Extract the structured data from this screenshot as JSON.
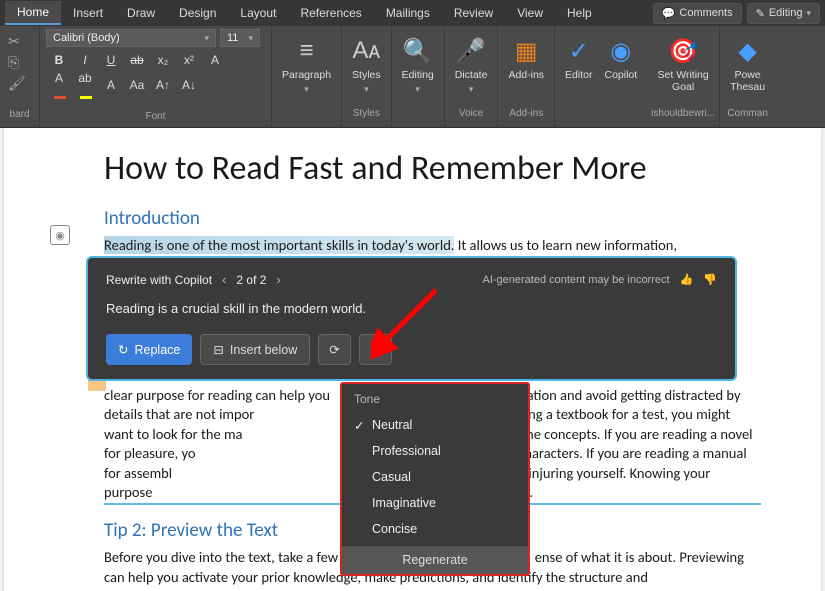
{
  "tabs": [
    "Home",
    "Insert",
    "Draw",
    "Design",
    "Layout",
    "References",
    "Mailings",
    "Review",
    "View",
    "Help"
  ],
  "active_tab": "Home",
  "top_right": {
    "comments": "Comments",
    "editing": "Editing"
  },
  "font": {
    "name": "Calibri (Body)",
    "size": "11"
  },
  "ribbon": {
    "clipboard_label": "bard",
    "font_label": "Font",
    "paragraph": "Paragraph",
    "styles": "Styles",
    "styles_label": "Styles",
    "editing": "Editing",
    "dictate": "Dictate",
    "voice_label": "Voice",
    "addins": "Add-ins",
    "addins_label": "Add-ins",
    "editor": "Editor",
    "copilot": "Copilot",
    "set_writing_goal": "Set Writing\nGoal",
    "ishould_label": "ishouldbewri...",
    "power_thesaurus": "Powe\nThesau",
    "commands_label": "Comman"
  },
  "doc": {
    "title": "How to Read Fast and Remember More",
    "h_intro": "Introduction",
    "p_intro_hl": "Reading is one of the most important skills in today's world.",
    "p_intro_rest": " It allows us to learn new information,",
    "p_body1": "clear purpose for reading can help you ",
    "p_body1b": "ation and avoid getting distracted by details that are not impor",
    "p_body1c": "you are reading a textbook for a test, you might want to look for the ma",
    "p_body1d": "that illustrate the concepts. If you are reading a novel for pleasure, yo",
    "p_body1e": "f in the story and the characters. If you are reading a manual for assembl",
    "p_body1f": "avoid breaking anything or injuring yourself. Knowing your purpose",
    "p_body1g": "speed and strategy accordingly.",
    "h_tip2": "Tip 2: Preview the Text",
    "p_tip2a": "Before you dive into the text, take a few",
    "p_tip2b": "ense of what it is about. Previewing can help you activate your prior knowledge, make predictions, and identify the structure and"
  },
  "copilot": {
    "title": "Rewrite with Copilot",
    "counter": "2 of 2",
    "warning": "AI-generated content may be incorrect",
    "suggestion": "Reading is a crucial skill in the modern world.",
    "replace": "Replace",
    "insert_below": "Insert below"
  },
  "tone": {
    "title": "Tone",
    "items": [
      "Neutral",
      "Professional",
      "Casual",
      "Imaginative",
      "Concise"
    ],
    "selected": "Neutral",
    "regenerate": "Regenerate"
  }
}
